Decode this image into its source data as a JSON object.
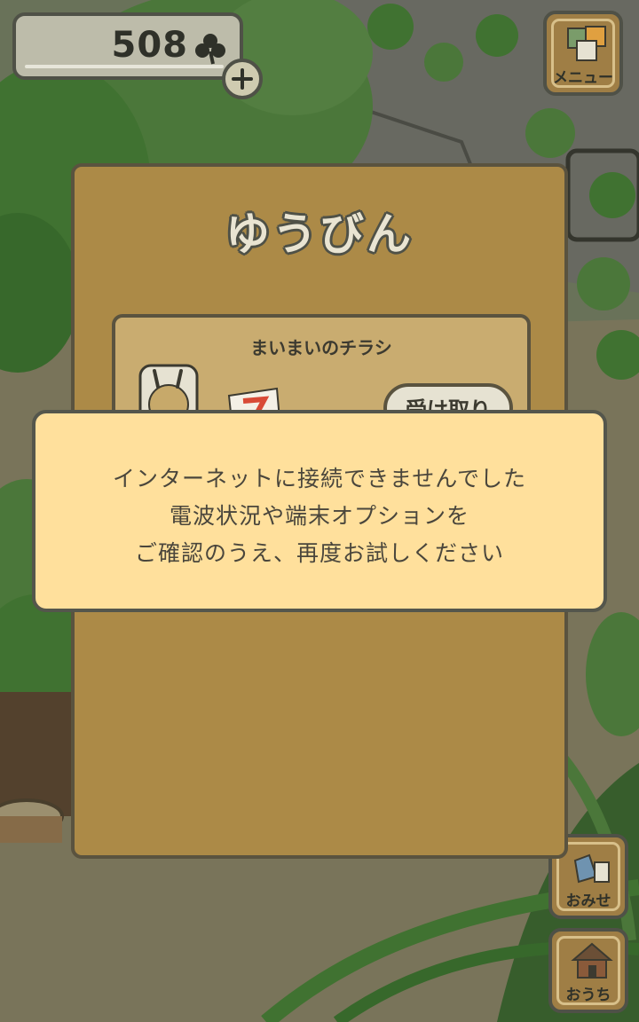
{
  "hud": {
    "clover_count": "508",
    "clover_icon": "clover-icon",
    "add_icon": "plus-icon"
  },
  "side_menu": {
    "menu_label": "メニュー",
    "shop_label": "おみせ",
    "home_label": "おうち"
  },
  "mail_panel": {
    "title": "ゆうびん",
    "items": [
      {
        "title": "まいまいのチラシ",
        "button_label": "受け取り"
      }
    ]
  },
  "error_dialog": {
    "lines": [
      "インターネットに接続できませんでした",
      "電波状況や端末オプションを",
      "ご確認のうえ、再度お試しください"
    ]
  },
  "colors": {
    "panel": "#ac8a47",
    "dialog": "#ffe09c",
    "outline": "#54564c",
    "leaf": "#4e9a3c"
  }
}
